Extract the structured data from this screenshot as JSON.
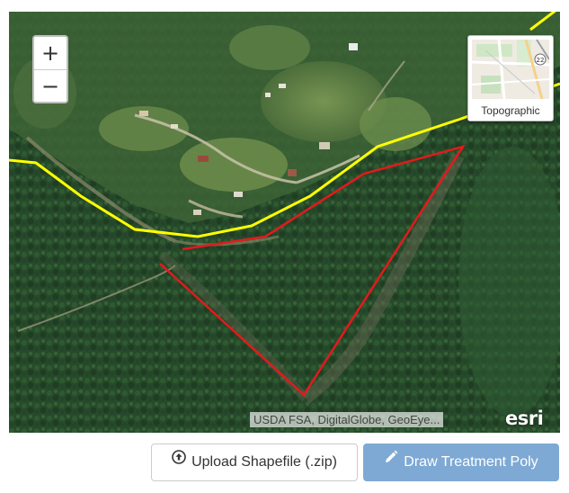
{
  "map": {
    "zoom_in_label": "+",
    "zoom_out_label": "−",
    "basemap_label": "Topographic",
    "attribution": "USDA FSA, DigitalGlobe, GeoEye...",
    "logo_text": "esri",
    "thumbnail_labels": [
      "22"
    ],
    "boundary_color": "#ffff00",
    "polygon_color": "#e31a1c"
  },
  "buttons": {
    "upload_label": "Upload Shapefile (.zip)",
    "upload_icon": "upload-circle-icon",
    "draw_label": "Draw Treatment Poly",
    "draw_icon": "pencil-icon",
    "draw_color": "#7ea9d4"
  }
}
